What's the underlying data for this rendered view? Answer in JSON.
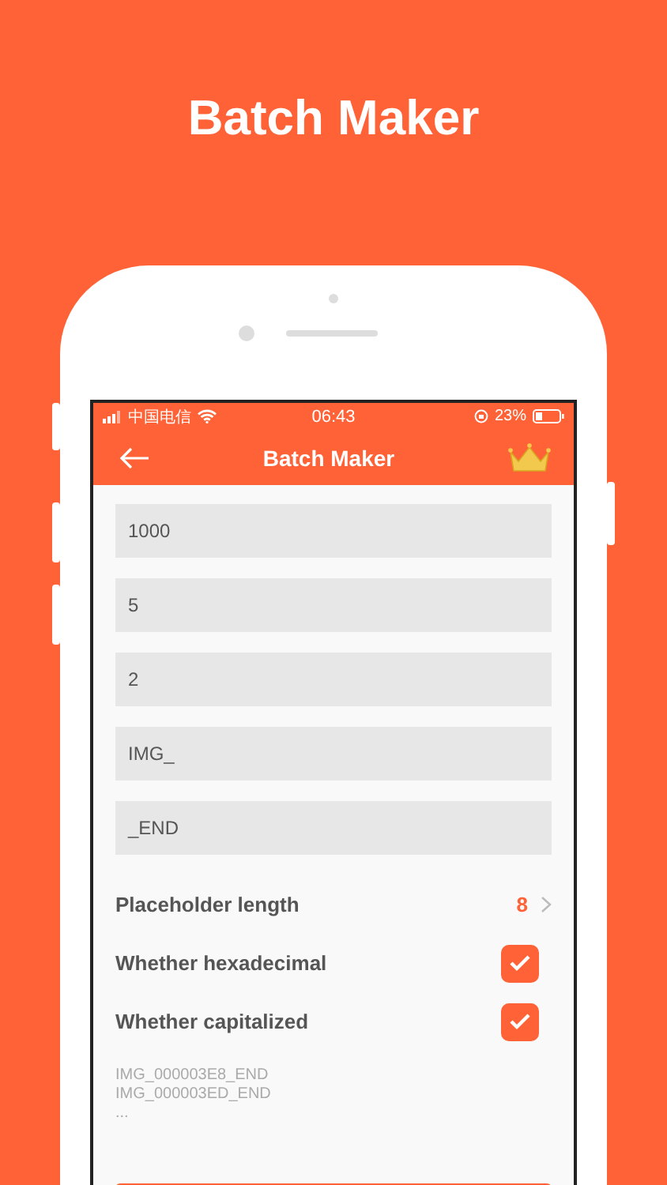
{
  "headline": "Batch Maker",
  "status_bar": {
    "carrier": "中国电信",
    "time": "06:43",
    "battery": "23%"
  },
  "nav": {
    "title": "Batch Maker"
  },
  "fields": [
    {
      "value": "1000"
    },
    {
      "value": "5"
    },
    {
      "value": "2"
    },
    {
      "value": "IMG_"
    },
    {
      "value": "_END"
    }
  ],
  "settings": [
    {
      "kind": "value",
      "label": "Placeholder length",
      "value": "8"
    },
    {
      "kind": "checkbox",
      "label": "Whether hexadecimal",
      "checked": true
    },
    {
      "kind": "checkbox",
      "label": "Whether capitalized",
      "checked": true
    }
  ],
  "preview": [
    "IMG_000003E8_END",
    "IMG_000003ED_END",
    "..."
  ]
}
